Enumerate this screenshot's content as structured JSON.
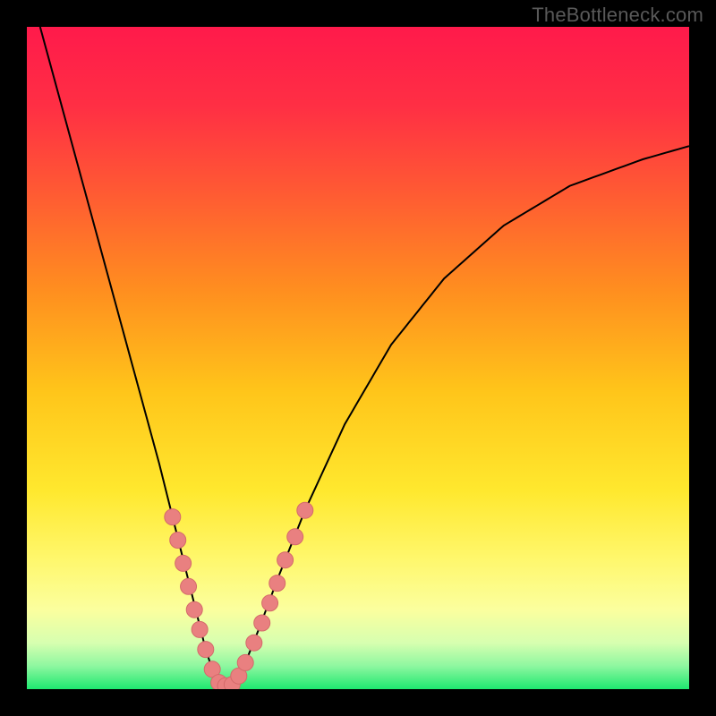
{
  "watermark": "TheBottleneck.com",
  "colors": {
    "frame": "#000000",
    "curve_stroke": "#000000",
    "marker_fill": "#e98080",
    "marker_stroke": "#d46a6a",
    "gradient_stops": [
      {
        "offset": 0.0,
        "color": "#ff1a4b"
      },
      {
        "offset": 0.12,
        "color": "#ff2f44"
      },
      {
        "offset": 0.25,
        "color": "#ff5a33"
      },
      {
        "offset": 0.4,
        "color": "#ff8f1f"
      },
      {
        "offset": 0.55,
        "color": "#ffc51a"
      },
      {
        "offset": 0.7,
        "color": "#ffe82e"
      },
      {
        "offset": 0.8,
        "color": "#fff76a"
      },
      {
        "offset": 0.88,
        "color": "#fbff9e"
      },
      {
        "offset": 0.93,
        "color": "#d7ffb0"
      },
      {
        "offset": 0.965,
        "color": "#8ef7a0"
      },
      {
        "offset": 1.0,
        "color": "#1ee86f"
      }
    ]
  },
  "chart_data": {
    "type": "line",
    "title": "",
    "xlabel": "",
    "ylabel": "",
    "xlim": [
      0,
      100
    ],
    "ylim": [
      0,
      100
    ],
    "grid": false,
    "series": [
      {
        "name": "bottleneck-curve",
        "x": [
          2,
          5,
          8,
          11,
          14,
          17,
          20,
          22,
          24,
          26,
          27,
          28,
          29,
          30,
          31,
          33,
          35,
          38,
          42,
          48,
          55,
          63,
          72,
          82,
          93,
          100
        ],
        "y": [
          100,
          89,
          78,
          67,
          56,
          45,
          34,
          26,
          18,
          10,
          6,
          3,
          1,
          0,
          1,
          4,
          9,
          17,
          27,
          40,
          52,
          62,
          70,
          76,
          80,
          82
        ]
      }
    ],
    "markers": {
      "name": "highlighted-points",
      "x": [
        22.0,
        22.8,
        23.6,
        24.4,
        25.3,
        26.1,
        27.0,
        28.0,
        29.0,
        30.0,
        31.0,
        32.0,
        33.0,
        34.3,
        35.5,
        36.7,
        37.8,
        39.0,
        40.5,
        42.0
      ],
      "y": [
        26.0,
        22.5,
        19.0,
        15.5,
        12.0,
        9.0,
        6.0,
        3.0,
        1.0,
        0.5,
        0.7,
        2.0,
        4.0,
        7.0,
        10.0,
        13.0,
        16.0,
        19.5,
        23.0,
        27.0
      ]
    }
  }
}
